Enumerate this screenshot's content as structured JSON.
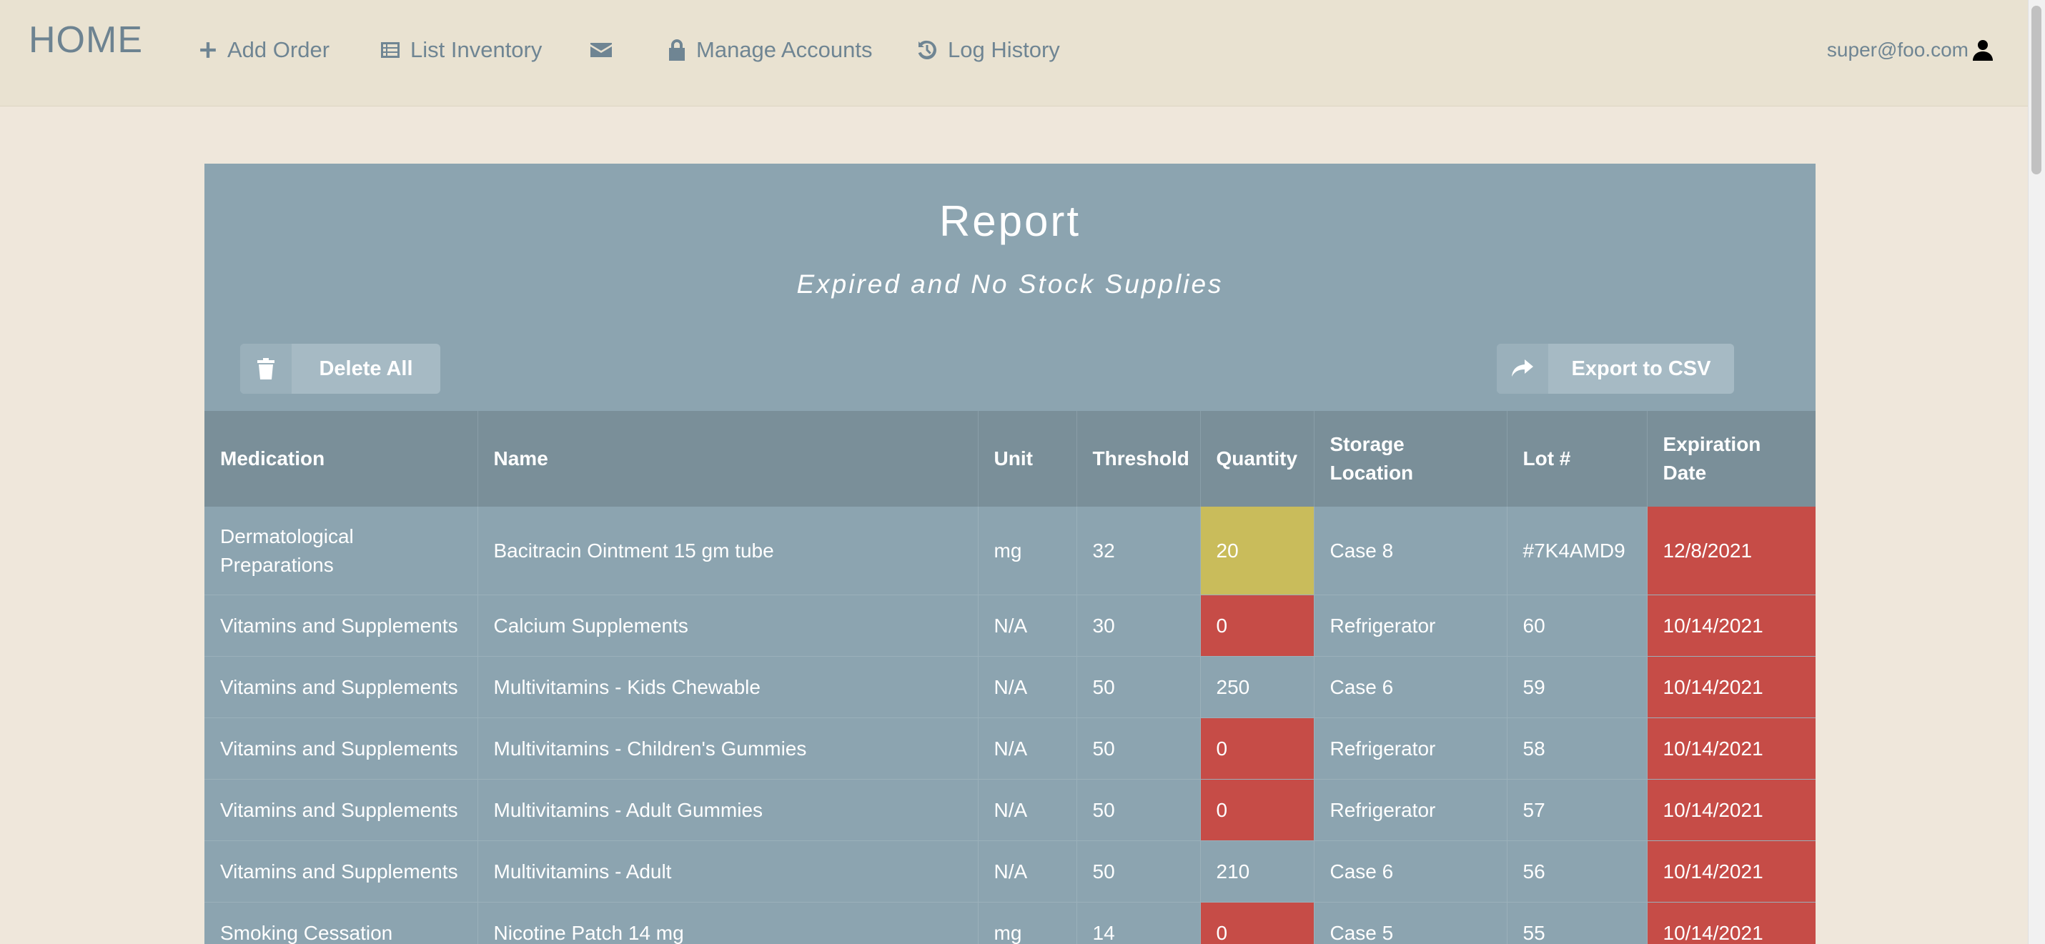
{
  "navbar": {
    "brand": "HOME",
    "add_order": "Add Order",
    "list_inventory": "List Inventory",
    "manage_accounts": "Manage Accounts",
    "log_history": "Log History",
    "user": "super@foo.com"
  },
  "report": {
    "title": "Report",
    "subtitle": "Expired and No Stock Supplies",
    "delete_all": "Delete All",
    "export_csv": "Export to CSV"
  },
  "table": {
    "headers": {
      "medication": "Medication",
      "name": "Name",
      "unit": "Unit",
      "threshold": "Threshold",
      "quantity": "Quantity",
      "storage": "Storage Location",
      "lot": "Lot #",
      "expiration": "Expiration Date"
    },
    "rows": [
      {
        "medication": "Dermatological Preparations",
        "name": "Bacitracin Ointment 15 gm tube",
        "unit": "mg",
        "threshold": "32",
        "quantity": "20",
        "quantity_status": "low",
        "storage": "Case 8",
        "lot": "#7K4AMD9",
        "expiration": "12/8/2021"
      },
      {
        "medication": "Vitamins and Supplements",
        "name": "Calcium Supplements",
        "unit": "N/A",
        "threshold": "30",
        "quantity": "0",
        "quantity_status": "out",
        "storage": "Refrigerator",
        "lot": "60",
        "expiration": "10/14/2021"
      },
      {
        "medication": "Vitamins and Supplements",
        "name": "Multivitamins - Kids Chewable",
        "unit": "N/A",
        "threshold": "50",
        "quantity": "250",
        "quantity_status": "ok",
        "storage": "Case 6",
        "lot": "59",
        "expiration": "10/14/2021"
      },
      {
        "medication": "Vitamins and Supplements",
        "name": "Multivitamins - Children's Gummies",
        "unit": "N/A",
        "threshold": "50",
        "quantity": "0",
        "quantity_status": "out",
        "storage": "Refrigerator",
        "lot": "58",
        "expiration": "10/14/2021"
      },
      {
        "medication": "Vitamins and Supplements",
        "name": "Multivitamins - Adult Gummies",
        "unit": "N/A",
        "threshold": "50",
        "quantity": "0",
        "quantity_status": "out",
        "storage": "Refrigerator",
        "lot": "57",
        "expiration": "10/14/2021"
      },
      {
        "medication": "Vitamins and Supplements",
        "name": "Multivitamins - Adult",
        "unit": "N/A",
        "threshold": "50",
        "quantity": "210",
        "quantity_status": "ok",
        "storage": "Case 6",
        "lot": "56",
        "expiration": "10/14/2021"
      },
      {
        "medication": "Smoking Cessation",
        "name": "Nicotine Patch 14 mg",
        "unit": "mg",
        "threshold": "14",
        "quantity": "0",
        "quantity_status": "out",
        "storage": "Case 5",
        "lot": "55",
        "expiration": "10/14/2021"
      }
    ]
  },
  "colors": {
    "navbar_bg": "#e9e2d1",
    "page_bg": "#efe7db",
    "panel_bg": "#8ca4b0",
    "header_bg": "#7a8f99",
    "low_stock": "#c9bc5b",
    "out_of_stock": "#c64c47",
    "expired": "#c64c47"
  }
}
